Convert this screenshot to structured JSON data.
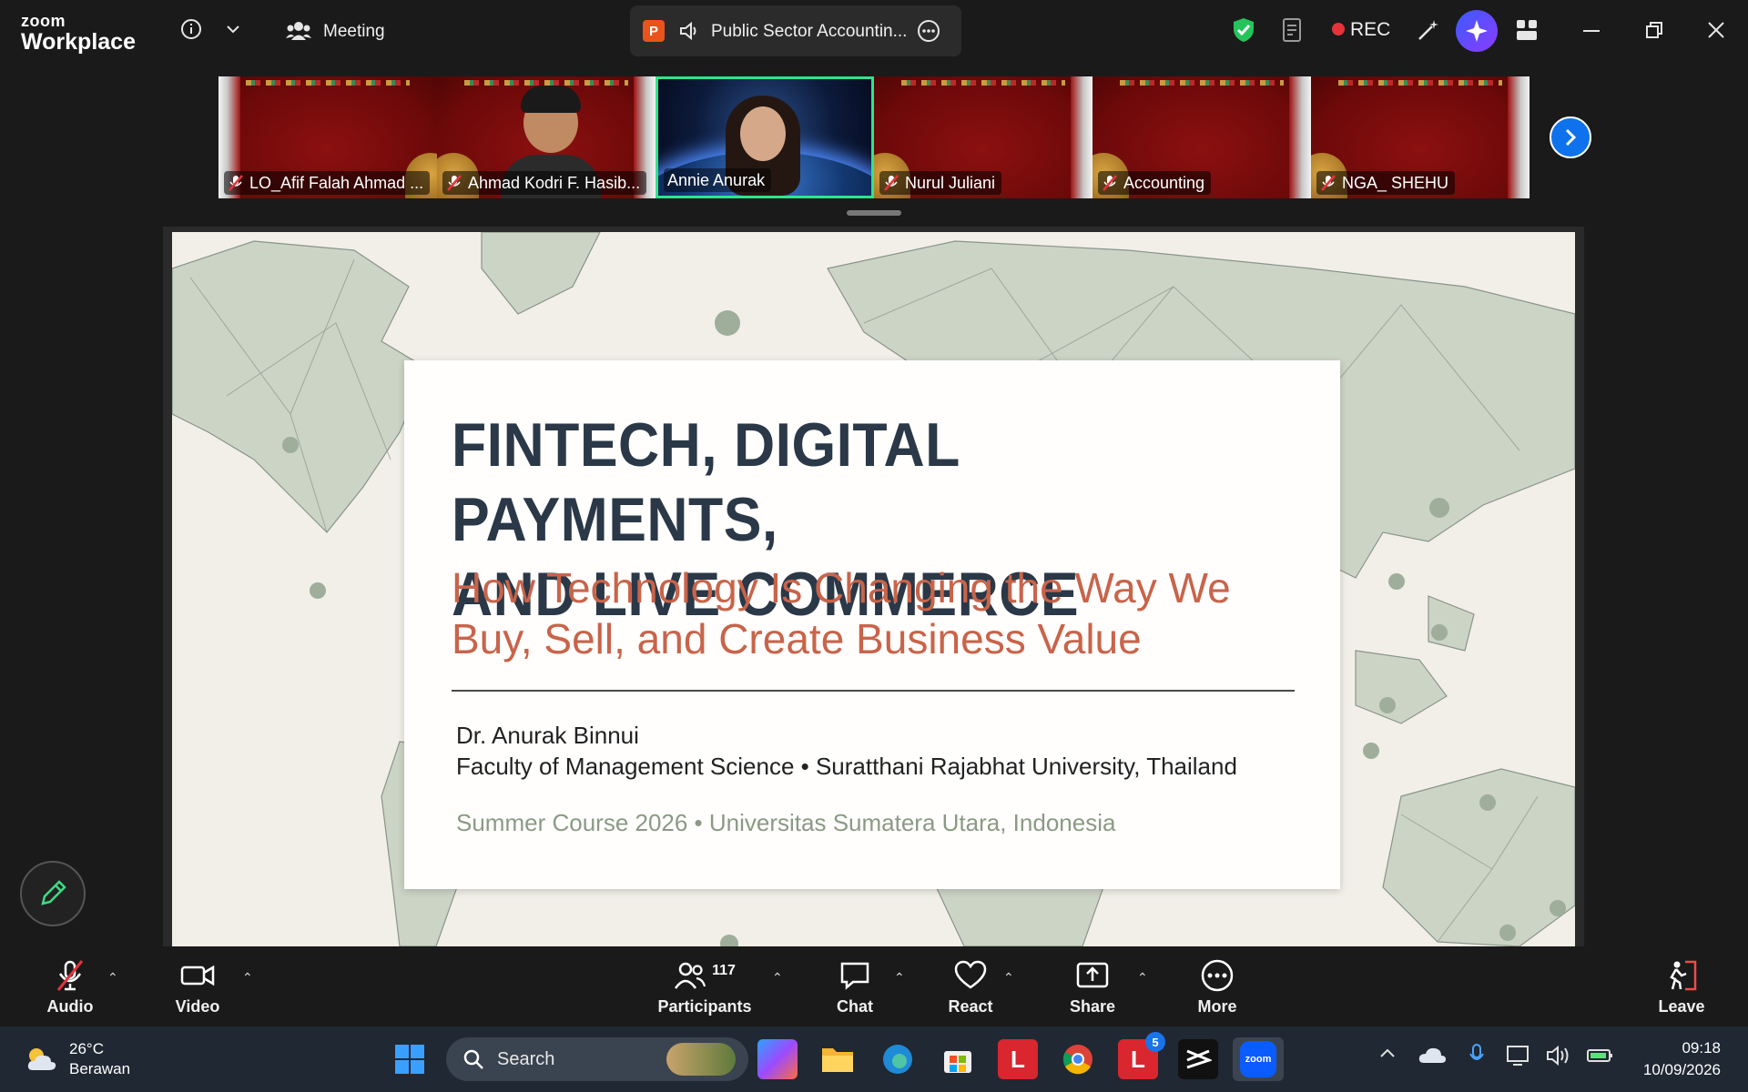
{
  "app": {
    "brand_small": "zoom",
    "brand_large": "Workplace"
  },
  "titlebar": {
    "meeting_label": "Meeting",
    "share_title": "Public Sector Accountin...",
    "share_app_badge": "P",
    "rec_label": "REC"
  },
  "participants_strip": [
    {
      "name": "LO_Afif Falah Ahmad ...",
      "muted": true
    },
    {
      "name": "Ahmad Kodri F. Hasib...",
      "muted": true
    },
    {
      "name": "Annie Anurak",
      "muted": false,
      "active_speaker": true
    },
    {
      "name": "Nurul Juliani",
      "muted": true
    },
    {
      "name": "Accounting",
      "muted": true
    },
    {
      "name": "NGA_ SHEHU",
      "muted": true
    }
  ],
  "slide": {
    "title_line1": "FINTECH, DIGITAL PAYMENTS,",
    "title_line2": "AND LIVE COMMERCE",
    "subtitle_line1": "How Technology Is Changing the Way We",
    "subtitle_line2": "Buy, Sell, and Create Business Value",
    "author_name": "Dr. Anurak Binnui",
    "author_affiliation": "Faculty of Management Science • Suratthani Rajabhat University, Thailand",
    "course_line": "Summer Course 2026 • Universitas Sumatera Utara, Indonesia"
  },
  "toolbar": {
    "audio": "Audio",
    "video": "Video",
    "participants": "Participants",
    "participants_count": "117",
    "chat": "Chat",
    "react": "React",
    "share": "Share",
    "more": "More",
    "leave": "Leave"
  },
  "taskbar": {
    "temperature": "26°C",
    "weather_desc": "Berawan",
    "search_placeholder": "Search",
    "notification_badge": "5",
    "time": "09:18",
    "date": "10/09/2026"
  },
  "colors": {
    "accent_blue": "#0e72ed",
    "active_speaker": "#2ee58a",
    "rec_red": "#e5323b",
    "slide_title": "#2a3847",
    "slide_subtitle": "#c8644a",
    "course_text": "#8a9a84"
  }
}
